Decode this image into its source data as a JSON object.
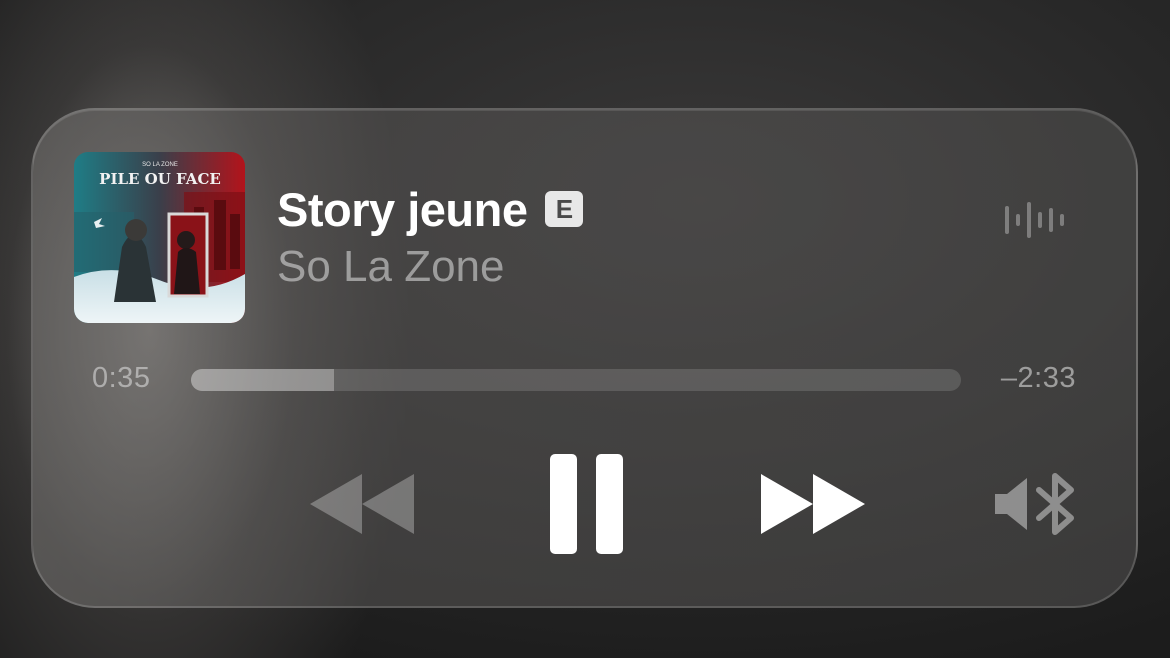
{
  "track": {
    "title": "Story jeune",
    "explicit_badge": "E",
    "artist": "So La Zone",
    "artwork": {
      "album_text_top": "SO LA ZONE",
      "album_title": "PILE OU FACE"
    }
  },
  "progress": {
    "elapsed": "0:35",
    "remaining": "–2:33",
    "fraction": 0.186
  },
  "controls": {
    "rewind_icon": "backward-icon",
    "pause_icon": "pause-icon",
    "forward_icon": "forward-icon",
    "output_icon": "speaker-bluetooth-icon",
    "waveform_icon": "waveform-icon"
  },
  "colors": {
    "accent_red": "#d8262b",
    "accent_teal": "#2f8f9a"
  }
}
